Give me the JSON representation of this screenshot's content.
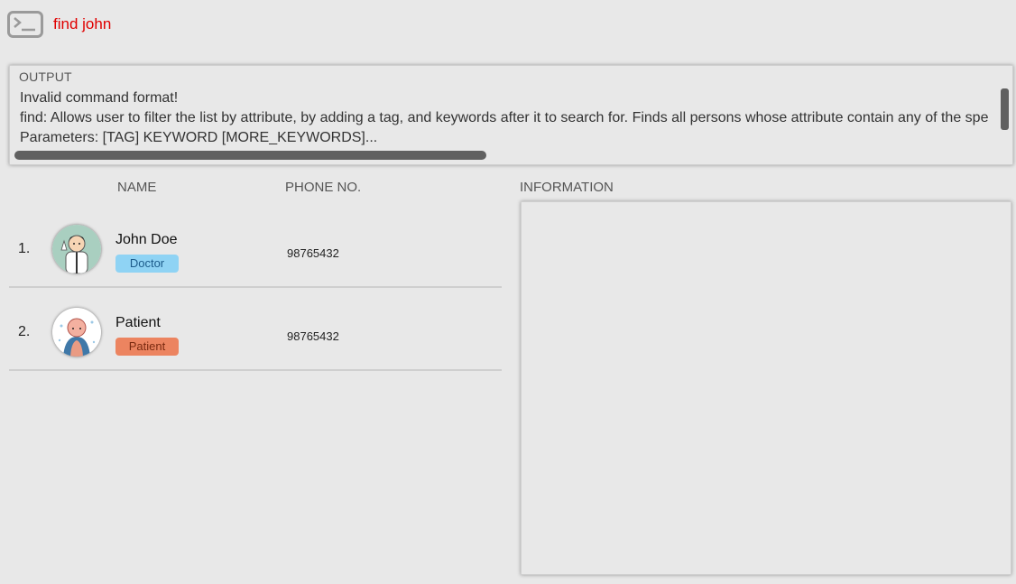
{
  "command": {
    "value": "find john",
    "icon": "terminal-icon"
  },
  "output": {
    "label": "OUTPUT",
    "lines": [
      "Invalid command format!",
      "find: Allows user to filter the list by attribute, by adding a tag, and keywords after it to search for. Finds all persons whose attribute contain any of the spe",
      "Parameters: [TAG] KEYWORD [MORE_KEYWORDS]..."
    ]
  },
  "list": {
    "headers": {
      "name": "NAME",
      "phone": "PHONE NO."
    },
    "persons": [
      {
        "index": "1.",
        "name": "John Doe",
        "tag": "Doctor",
        "phone": "98765432",
        "avatar": "doctor-avatar-icon"
      },
      {
        "index": "2.",
        "name": "Patient",
        "tag": "Patient",
        "phone": "98765432",
        "avatar": "patient-avatar-icon"
      }
    ]
  },
  "info": {
    "label": "INFORMATION"
  },
  "colors": {
    "command_text": "#e00000",
    "doctor_tag": "#8fd3f4",
    "patient_tag": "#ec8460"
  }
}
